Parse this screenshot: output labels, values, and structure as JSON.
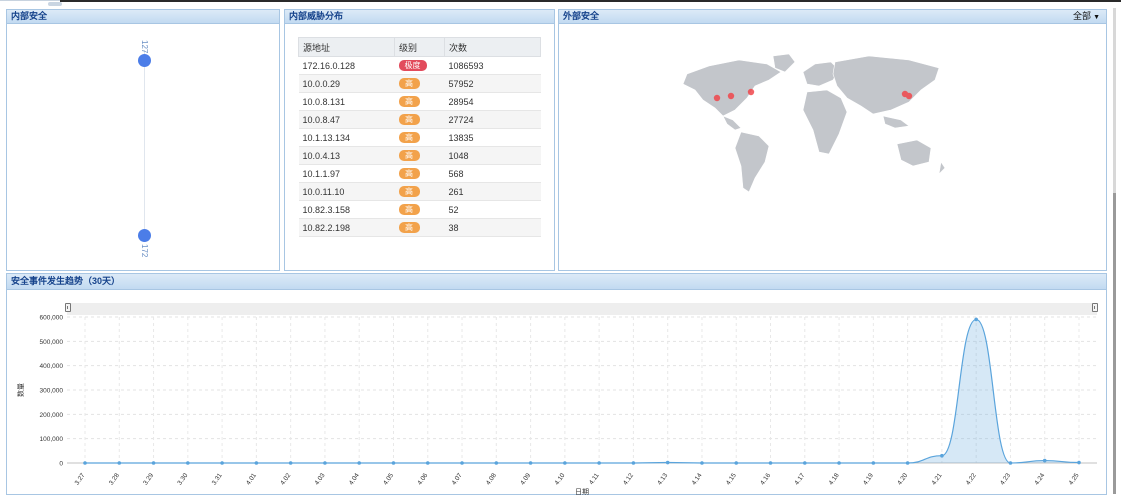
{
  "internal_security": {
    "title": "内部安全",
    "slider_top_label": "127",
    "slider_bottom_label": "172"
  },
  "threat_distribution": {
    "title": "内部威胁分布",
    "columns": [
      "源地址",
      "级别",
      "次数"
    ],
    "rows": [
      {
        "ip": "172.16.0.128",
        "level": "极度",
        "level_color": "#e24b5c",
        "count": "1086593"
      },
      {
        "ip": "10.0.0.29",
        "level": "高",
        "level_color": "#f2a24b",
        "count": "57952"
      },
      {
        "ip": "10.0.8.131",
        "level": "高",
        "level_color": "#f2a24b",
        "count": "28954"
      },
      {
        "ip": "10.0.8.47",
        "level": "高",
        "level_color": "#f2a24b",
        "count": "27724"
      },
      {
        "ip": "10.1.13.134",
        "level": "高",
        "level_color": "#f2a24b",
        "count": "13835"
      },
      {
        "ip": "10.0.4.13",
        "level": "高",
        "level_color": "#f2a24b",
        "count": "1048"
      },
      {
        "ip": "10.1.1.97",
        "level": "高",
        "level_color": "#f2a24b",
        "count": "568"
      },
      {
        "ip": "10.0.11.10",
        "level": "高",
        "level_color": "#f2a24b",
        "count": "261"
      },
      {
        "ip": "10.82.3.158",
        "level": "高",
        "level_color": "#f2a24b",
        "count": "52"
      },
      {
        "ip": "10.82.2.198",
        "level": "高",
        "level_color": "#f2a24b",
        "count": "38"
      }
    ]
  },
  "external_security": {
    "title": "外部安全",
    "filter_label": "全部",
    "map_hotspots": [
      "us-west",
      "us-central",
      "us-east",
      "china-east"
    ]
  },
  "trend": {
    "title": "安全事件发生趋势（30天）"
  },
  "chart_data": {
    "type": "area",
    "title": "",
    "xlabel": "日期",
    "ylabel": "数量",
    "ylim": [
      0,
      600000
    ],
    "yticks": [
      "0",
      "100,000",
      "200,000",
      "300,000",
      "400,000",
      "500,000",
      "600,000"
    ],
    "grid": true,
    "categories": [
      "3.27",
      "3.28",
      "3.29",
      "3.30",
      "3.31",
      "4.01",
      "4.02",
      "4.03",
      "4.04",
      "4.05",
      "4.06",
      "4.07",
      "4.08",
      "4.09",
      "4.10",
      "4.11",
      "4.12",
      "4.13",
      "4.14",
      "4.15",
      "4.16",
      "4.17",
      "4.18",
      "4.19",
      "4.20",
      "4.21",
      "4.22",
      "4.23",
      "4.24",
      "4.25"
    ],
    "series": [
      {
        "color": "#5aa4dc",
        "values": [
          0,
          0,
          0,
          0,
          0,
          0,
          0,
          0,
          0,
          0,
          0,
          0,
          0,
          0,
          0,
          0,
          0,
          2000,
          0,
          0,
          0,
          0,
          0,
          0,
          0,
          30000,
          590000,
          0,
          10000,
          2000
        ]
      }
    ]
  },
  "colors": {
    "panel_border": "#a8c6e3",
    "panel_title": "#15428b",
    "slider_dot": "#4b7de8",
    "map_land": "#c3c6cb",
    "hotspot": "#f0474c"
  }
}
